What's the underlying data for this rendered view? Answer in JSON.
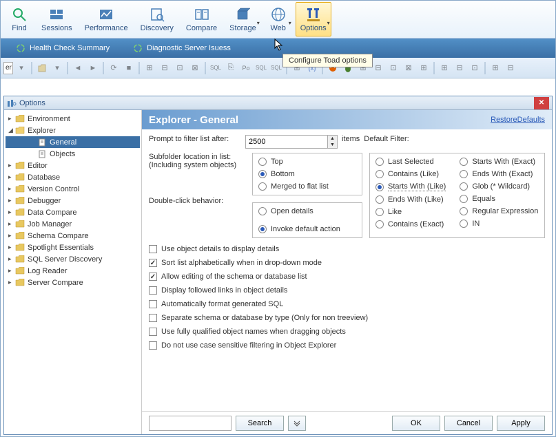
{
  "ribbon": [
    {
      "label": "Find",
      "icon": "find"
    },
    {
      "label": "Sessions",
      "icon": "sessions"
    },
    {
      "label": "Performance",
      "icon": "perf"
    },
    {
      "label": "Discovery",
      "icon": "discovery"
    },
    {
      "label": "Compare",
      "icon": "compare"
    },
    {
      "label": "Storage",
      "icon": "storage"
    },
    {
      "label": "Web",
      "icon": "web"
    },
    {
      "label": "Options",
      "icon": "options",
      "selected": true
    }
  ],
  "tooltip": "Configure Toad options",
  "tabs": [
    {
      "label": "Health Check Summary"
    },
    {
      "label": "Diagnostic Server Isuess"
    }
  ],
  "toolrow_er": "er",
  "panel_title": "Options",
  "tree": {
    "items": [
      {
        "label": "Environment",
        "depth": 0,
        "arrow": "▸",
        "folder": true
      },
      {
        "label": "Explorer",
        "depth": 0,
        "arrow": "◢",
        "folder": true,
        "open": true
      },
      {
        "label": "General",
        "depth": 2,
        "selected": true,
        "doc": true
      },
      {
        "label": "Objects",
        "depth": 2,
        "doc": true
      },
      {
        "label": "Editor",
        "depth": 0,
        "arrow": "▸",
        "folder": true
      },
      {
        "label": "Database",
        "depth": 0,
        "arrow": "▸",
        "folder": true
      },
      {
        "label": "Version Control",
        "depth": 0,
        "arrow": "▸",
        "folder": true
      },
      {
        "label": "Debugger",
        "depth": 0,
        "arrow": "▸",
        "folder": true
      },
      {
        "label": "Data Compare",
        "depth": 0,
        "arrow": "▸",
        "folder": true
      },
      {
        "label": "Job Manager",
        "depth": 0,
        "arrow": "▸",
        "folder": true
      },
      {
        "label": "Schema Compare",
        "depth": 0,
        "arrow": "▸",
        "folder": true
      },
      {
        "label": "Spotlight Essentials",
        "depth": 0,
        "arrow": "▸",
        "folder": true
      },
      {
        "label": "SQL Server Discovery",
        "depth": 0,
        "arrow": "▸",
        "folder": true
      },
      {
        "label": "Log Reader",
        "depth": 0,
        "arrow": "▸",
        "folder": true
      },
      {
        "label": "Server Compare",
        "depth": 0,
        "arrow": "▸",
        "folder": true
      }
    ]
  },
  "content": {
    "title": "Explorer - General",
    "restore": "RestoreDefaults",
    "prompt_label": "Prompt to filter list after:",
    "prompt_value": "2500",
    "prompt_suffix": "items",
    "default_filter_label": "Default Filter:",
    "subfolder_label1": "Subfolder location in list:",
    "subfolder_label2": "(Including system objects)",
    "subfolder_opts": [
      {
        "label": "Top",
        "checked": false
      },
      {
        "label": "Bottom",
        "checked": true
      },
      {
        "label": "Merged to flat list",
        "checked": false
      }
    ],
    "dblclick_label": "Double-click behavior:",
    "dblclick_opts": [
      {
        "label": "Open details",
        "checked": false
      },
      {
        "label": "Invoke default action",
        "checked": true
      }
    ],
    "filter_opts_col1": [
      {
        "label": "Last Selected"
      },
      {
        "label": "Contains (Like)"
      },
      {
        "label": "Starts With (Like)",
        "checked": true
      },
      {
        "label": "Ends With (Like)"
      },
      {
        "label": "Like"
      },
      {
        "label": "Contains (Exact)"
      }
    ],
    "filter_opts_col2": [
      {
        "label": "Starts With (Exact)"
      },
      {
        "label": "Ends With (Exact)"
      },
      {
        "label": "Glob (* Wildcard)"
      },
      {
        "label": "Equals"
      },
      {
        "label": "Regular Expression"
      },
      {
        "label": "IN"
      }
    ],
    "checks": [
      {
        "label": "Use object details to display details",
        "checked": false
      },
      {
        "label": "Sort list alphabetically when in drop-down mode",
        "checked": true
      },
      {
        "label": "Allow editing of the schema or database list",
        "checked": true
      },
      {
        "label": "Display followed links in object details",
        "checked": false
      },
      {
        "label": "Automatically format generated SQL",
        "checked": false
      },
      {
        "label": "Separate schema or database by type (Only for non treeview)",
        "checked": false
      },
      {
        "label": "Use fully qualified object names when dragging objects",
        "checked": false
      },
      {
        "label": "Do not use case sensitive filtering in Object Explorer",
        "checked": false
      }
    ],
    "footer": {
      "search": "Search",
      "ok": "OK",
      "cancel": "Cancel",
      "apply": "Apply"
    }
  }
}
